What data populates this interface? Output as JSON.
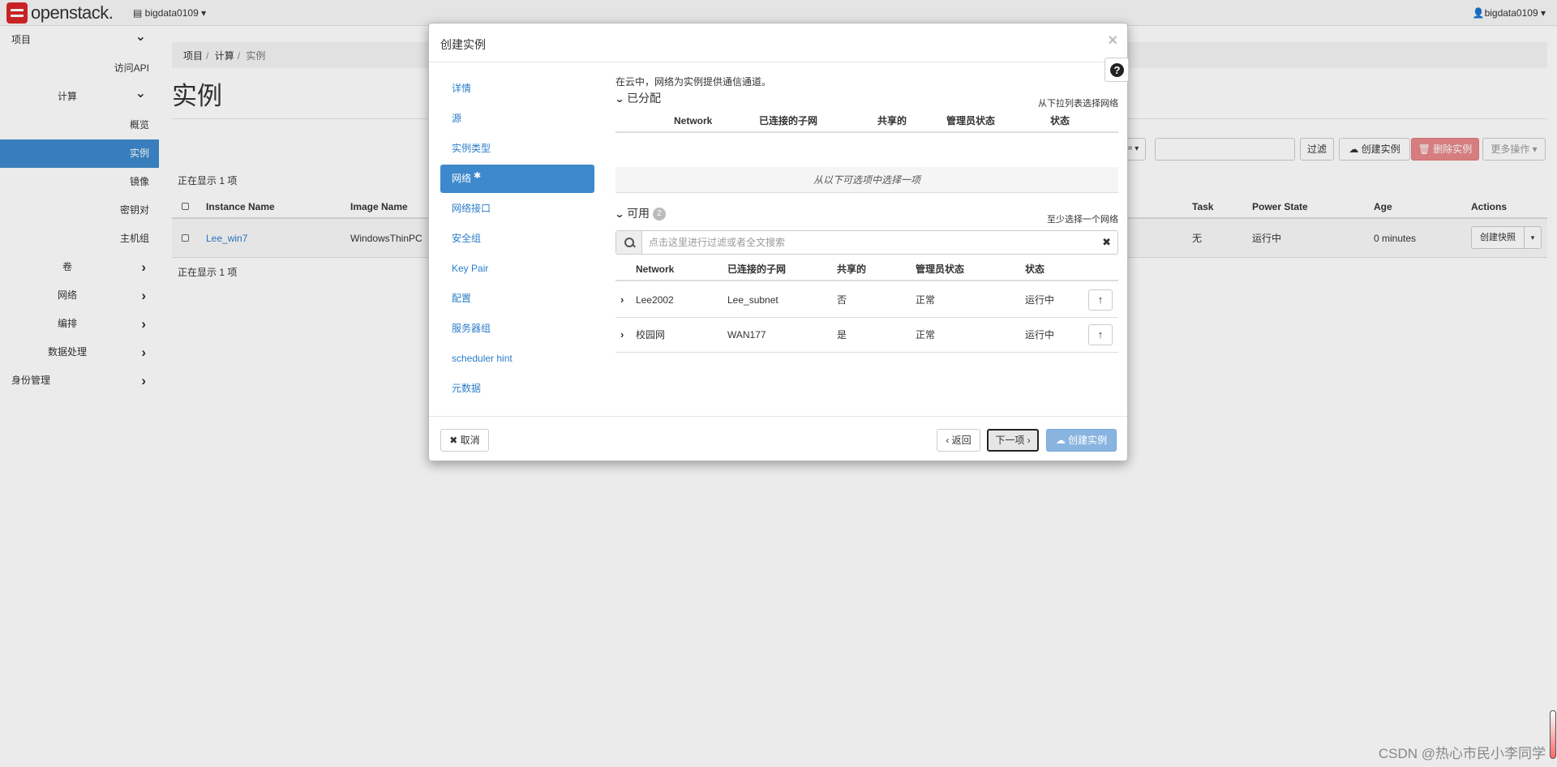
{
  "topbar": {
    "brand": "openstack.",
    "project": "bigdata0109",
    "user": "bigdata0109"
  },
  "sidebar": {
    "items": [
      {
        "label": "项目",
        "level": 0,
        "chevron": "down"
      },
      {
        "label": "访问API",
        "level": 2
      },
      {
        "label": "计算",
        "level": 1,
        "chevron": "down"
      },
      {
        "label": "概览",
        "level": 2
      },
      {
        "label": "实例",
        "level": 2,
        "active": true
      },
      {
        "label": "镜像",
        "level": 2
      },
      {
        "label": "密钥对",
        "level": 2
      },
      {
        "label": "主机组",
        "level": 2
      },
      {
        "label": "卷",
        "level": 1,
        "chevron": "right"
      },
      {
        "label": "网络",
        "level": 1,
        "chevron": "right"
      },
      {
        "label": "编排",
        "level": 1,
        "chevron": "right"
      },
      {
        "label": "数据处理",
        "level": 1,
        "chevron": "right"
      },
      {
        "label": "身份管理",
        "level": 0,
        "chevron": "right"
      }
    ]
  },
  "breadcrumb": [
    "项目",
    "计算",
    "实例"
  ],
  "page": {
    "title": "实例",
    "count_top": "正在显示 1 项",
    "count_bottom": "正在显示 1 项"
  },
  "toolbar": {
    "filter_drop": "= ▾",
    "filter_btn": "过滤",
    "create_btn": "创建实例",
    "delete_btn": "删除实例",
    "more_btn": "更多操作 ▾"
  },
  "instances_table": {
    "columns": [
      "Instance Name",
      "Image Name",
      "Task",
      "Power State",
      "Age",
      "Actions"
    ],
    "rows": [
      {
        "name": "Lee_win7",
        "image": "WindowsThinPC",
        "task": "无",
        "power": "运行中",
        "age": "0 minutes",
        "action": "创建快照"
      }
    ]
  },
  "modal": {
    "title": "创建实例",
    "close": "×",
    "help": "?",
    "nav": [
      {
        "label": "详情"
      },
      {
        "label": "源"
      },
      {
        "label": "实例类型"
      },
      {
        "label": "网络",
        "active": true,
        "required": "✱"
      },
      {
        "label": "网络接口"
      },
      {
        "label": "安全组"
      },
      {
        "label": "Key Pair"
      },
      {
        "label": "配置"
      },
      {
        "label": "服务器组"
      },
      {
        "label": "scheduler hint"
      },
      {
        "label": "元数据"
      }
    ],
    "description": "在云中，网络为实例提供通信通道。",
    "allocated": {
      "title": "已分配",
      "hint": "从下拉列表选择网络",
      "columns": [
        "Network",
        "已连接的子网",
        "共享的",
        "管理员状态",
        "状态"
      ],
      "empty": "从以下可选项中选择一项"
    },
    "available": {
      "title": "可用",
      "count": "2",
      "hint": "至少选择一个网络",
      "search_placeholder": "点击这里进行过滤或者全文搜索",
      "columns": [
        "Network",
        "已连接的子网",
        "共享的",
        "管理员状态",
        "状态"
      ],
      "rows": [
        {
          "network": "Lee2002",
          "subnet": "Lee_subnet",
          "shared": "否",
          "admin": "正常",
          "status": "运行中"
        },
        {
          "network": "校园网",
          "subnet": "WAN177",
          "shared": "是",
          "admin": "正常",
          "status": "运行中"
        }
      ]
    },
    "footer": {
      "cancel": "✖ 取消",
      "back": "‹ 返回",
      "next": "下一项 ›",
      "create": "创建实例"
    }
  },
  "watermark": "CSDN @热心市民小李同学"
}
